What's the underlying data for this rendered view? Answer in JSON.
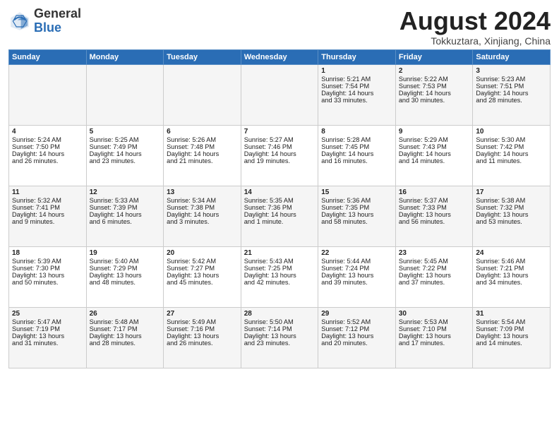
{
  "header": {
    "logo_line1": "General",
    "logo_line2": "Blue",
    "month_year": "August 2024",
    "location": "Tokkuztara, Xinjiang, China"
  },
  "weekdays": [
    "Sunday",
    "Monday",
    "Tuesday",
    "Wednesday",
    "Thursday",
    "Friday",
    "Saturday"
  ],
  "weeks": [
    [
      {
        "day": "",
        "content": ""
      },
      {
        "day": "",
        "content": ""
      },
      {
        "day": "",
        "content": ""
      },
      {
        "day": "",
        "content": ""
      },
      {
        "day": "1",
        "content": "Sunrise: 5:21 AM\nSunset: 7:54 PM\nDaylight: 14 hours\nand 33 minutes."
      },
      {
        "day": "2",
        "content": "Sunrise: 5:22 AM\nSunset: 7:53 PM\nDaylight: 14 hours\nand 30 minutes."
      },
      {
        "day": "3",
        "content": "Sunrise: 5:23 AM\nSunset: 7:51 PM\nDaylight: 14 hours\nand 28 minutes."
      }
    ],
    [
      {
        "day": "4",
        "content": "Sunrise: 5:24 AM\nSunset: 7:50 PM\nDaylight: 14 hours\nand 26 minutes."
      },
      {
        "day": "5",
        "content": "Sunrise: 5:25 AM\nSunset: 7:49 PM\nDaylight: 14 hours\nand 23 minutes."
      },
      {
        "day": "6",
        "content": "Sunrise: 5:26 AM\nSunset: 7:48 PM\nDaylight: 14 hours\nand 21 minutes."
      },
      {
        "day": "7",
        "content": "Sunrise: 5:27 AM\nSunset: 7:46 PM\nDaylight: 14 hours\nand 19 minutes."
      },
      {
        "day": "8",
        "content": "Sunrise: 5:28 AM\nSunset: 7:45 PM\nDaylight: 14 hours\nand 16 minutes."
      },
      {
        "day": "9",
        "content": "Sunrise: 5:29 AM\nSunset: 7:43 PM\nDaylight: 14 hours\nand 14 minutes."
      },
      {
        "day": "10",
        "content": "Sunrise: 5:30 AM\nSunset: 7:42 PM\nDaylight: 14 hours\nand 11 minutes."
      }
    ],
    [
      {
        "day": "11",
        "content": "Sunrise: 5:32 AM\nSunset: 7:41 PM\nDaylight: 14 hours\nand 9 minutes."
      },
      {
        "day": "12",
        "content": "Sunrise: 5:33 AM\nSunset: 7:39 PM\nDaylight: 14 hours\nand 6 minutes."
      },
      {
        "day": "13",
        "content": "Sunrise: 5:34 AM\nSunset: 7:38 PM\nDaylight: 14 hours\nand 3 minutes."
      },
      {
        "day": "14",
        "content": "Sunrise: 5:35 AM\nSunset: 7:36 PM\nDaylight: 14 hours\nand 1 minute."
      },
      {
        "day": "15",
        "content": "Sunrise: 5:36 AM\nSunset: 7:35 PM\nDaylight: 13 hours\nand 58 minutes."
      },
      {
        "day": "16",
        "content": "Sunrise: 5:37 AM\nSunset: 7:33 PM\nDaylight: 13 hours\nand 56 minutes."
      },
      {
        "day": "17",
        "content": "Sunrise: 5:38 AM\nSunset: 7:32 PM\nDaylight: 13 hours\nand 53 minutes."
      }
    ],
    [
      {
        "day": "18",
        "content": "Sunrise: 5:39 AM\nSunset: 7:30 PM\nDaylight: 13 hours\nand 50 minutes."
      },
      {
        "day": "19",
        "content": "Sunrise: 5:40 AM\nSunset: 7:29 PM\nDaylight: 13 hours\nand 48 minutes."
      },
      {
        "day": "20",
        "content": "Sunrise: 5:42 AM\nSunset: 7:27 PM\nDaylight: 13 hours\nand 45 minutes."
      },
      {
        "day": "21",
        "content": "Sunrise: 5:43 AM\nSunset: 7:25 PM\nDaylight: 13 hours\nand 42 minutes."
      },
      {
        "day": "22",
        "content": "Sunrise: 5:44 AM\nSunset: 7:24 PM\nDaylight: 13 hours\nand 39 minutes."
      },
      {
        "day": "23",
        "content": "Sunrise: 5:45 AM\nSunset: 7:22 PM\nDaylight: 13 hours\nand 37 minutes."
      },
      {
        "day": "24",
        "content": "Sunrise: 5:46 AM\nSunset: 7:21 PM\nDaylight: 13 hours\nand 34 minutes."
      }
    ],
    [
      {
        "day": "25",
        "content": "Sunrise: 5:47 AM\nSunset: 7:19 PM\nDaylight: 13 hours\nand 31 minutes."
      },
      {
        "day": "26",
        "content": "Sunrise: 5:48 AM\nSunset: 7:17 PM\nDaylight: 13 hours\nand 28 minutes."
      },
      {
        "day": "27",
        "content": "Sunrise: 5:49 AM\nSunset: 7:16 PM\nDaylight: 13 hours\nand 26 minutes."
      },
      {
        "day": "28",
        "content": "Sunrise: 5:50 AM\nSunset: 7:14 PM\nDaylight: 13 hours\nand 23 minutes."
      },
      {
        "day": "29",
        "content": "Sunrise: 5:52 AM\nSunset: 7:12 PM\nDaylight: 13 hours\nand 20 minutes."
      },
      {
        "day": "30",
        "content": "Sunrise: 5:53 AM\nSunset: 7:10 PM\nDaylight: 13 hours\nand 17 minutes."
      },
      {
        "day": "31",
        "content": "Sunrise: 5:54 AM\nSunset: 7:09 PM\nDaylight: 13 hours\nand 14 minutes."
      }
    ]
  ]
}
